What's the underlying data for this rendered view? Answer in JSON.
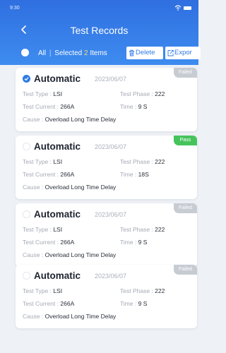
{
  "status_bar": {
    "time": "9:30"
  },
  "header": {
    "title": "Test Records"
  },
  "selection": {
    "all_label": "All",
    "separator": "|",
    "selected_label": "Selected",
    "selected_count": "2",
    "items_label": "Items",
    "delete_label": "Delete",
    "export_label": "Expor"
  },
  "labels": {
    "test_type": "Test Type :",
    "test_phase": "Test Phase :",
    "test_current": "Test Current :",
    "time": "Time :",
    "cause": "Cause :"
  },
  "records": [
    {
      "mode": "Automatic",
      "date": "2023/06/07",
      "status": "Failed",
      "checked": true,
      "test_type": "LSI",
      "test_phase": "222",
      "test_current": "266A",
      "time": "9 S",
      "cause": "Overload Long Time Delay"
    },
    {
      "mode": "Automatic",
      "date": "2023/06/07",
      "status": "Pass",
      "checked": false,
      "test_type": "LSI",
      "test_phase": "222",
      "test_current": "266A",
      "time": "18S",
      "cause": "Overload Long Time Delay"
    },
    {
      "mode": "Automatic",
      "date": "2023/06/07",
      "status": "Failed",
      "checked": false,
      "test_type": "LSI",
      "test_phase": "222",
      "test_current": "266A",
      "time": "9 S",
      "cause": "Overload Long Time Delay"
    },
    {
      "mode": "Automatic",
      "date": "2023/06/07",
      "status": "Failed",
      "checked": false,
      "test_type": "LSI",
      "test_phase": "222",
      "test_current": "266A",
      "time": "9 S",
      "cause": "Overload Long Time Delay"
    }
  ],
  "colors": {
    "header_gradient_top": "#2f6fe0",
    "header_gradient_bottom": "#3e8cf0",
    "accent": "#2f7be8",
    "pass": "#46c45c",
    "failed": "#c7cbd2",
    "selected_count": "#ffd86b",
    "background": "#eef1f6"
  },
  "icons": {
    "back": "chevron-left-icon",
    "delete": "trash-icon",
    "export": "export-icon",
    "check": "check-icon"
  }
}
